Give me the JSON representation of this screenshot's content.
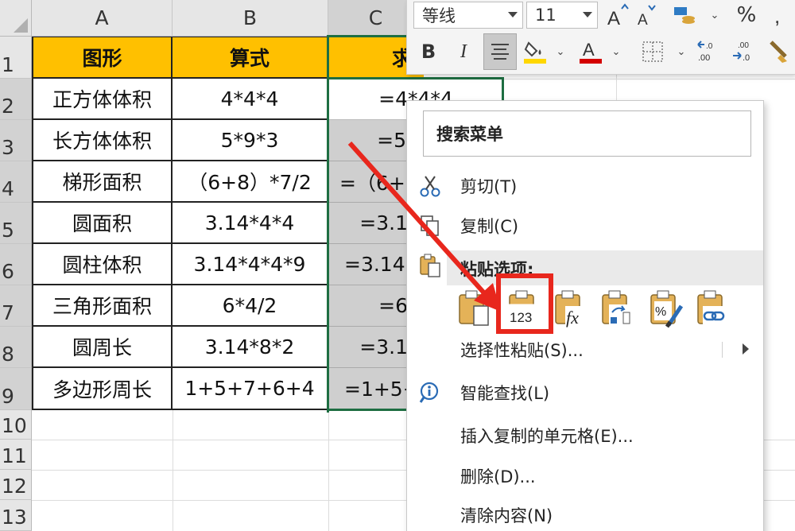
{
  "sheet": {
    "columns": [
      "A",
      "B",
      "C"
    ],
    "rows": [
      "1",
      "2",
      "3",
      "4",
      "5",
      "6",
      "7",
      "8",
      "9",
      "10",
      "11",
      "12",
      "13"
    ],
    "header_row": [
      "图形",
      "算式",
      "求"
    ],
    "data_rows": [
      {
        "shape": "正方体体积",
        "formula": "4*4*4",
        "result": "=4*4*4"
      },
      {
        "shape": "长方体体积",
        "formula": "5*9*3",
        "result": "=5"
      },
      {
        "shape": "梯形面积",
        "formula": "（6+8）*7/2",
        "result": "=（6+"
      },
      {
        "shape": "圆面积",
        "formula": "3.14*4*4",
        "result": "=3.1"
      },
      {
        "shape": "圆柱体积",
        "formula": "3.14*4*4*9",
        "result": "=3.14"
      },
      {
        "shape": "三角形面积",
        "formula": "6*4/2",
        "result": "=6"
      },
      {
        "shape": "圆周长",
        "formula": "3.14*8*2",
        "result": "=3.1"
      },
      {
        "shape": "多边形周长",
        "formula": "1+5+7+6+4",
        "result": "=1+5+"
      }
    ]
  },
  "mini_toolbar": {
    "font_name": "等线",
    "font_size": "11",
    "grow_font_icon": "font-grow-icon",
    "shrink_font_icon": "font-shrink-icon",
    "percent_label": "%",
    "bold_label": "B",
    "italic_label": "I"
  },
  "context_menu": {
    "search_label": "搜索菜单",
    "cut_label": "剪切(T)",
    "copy_label": "复制(C)",
    "paste_options_label": "粘贴选项:",
    "paste_special_label": "选择性粘贴(S)...",
    "smart_lookup_label": "智能查找(L)",
    "insert_copied_label": "插入复制的单元格(E)...",
    "delete_label": "删除(D)...",
    "clear_label": "清除内容(N)",
    "paste_icons": [
      "paste-icon",
      "paste-values-icon",
      "paste-formulas-icon",
      "paste-transpose-icon",
      "paste-formatting-icon",
      "paste-link-icon"
    ],
    "paste_values_text": "123",
    "paste_formulas_text": "fx"
  },
  "colors": {
    "header_fill": "#ffc000",
    "selection_border": "#1e6e42",
    "highlight_red": "#e8271d",
    "fill_yellow": "#ffd700",
    "font_red": "#d40000"
  }
}
